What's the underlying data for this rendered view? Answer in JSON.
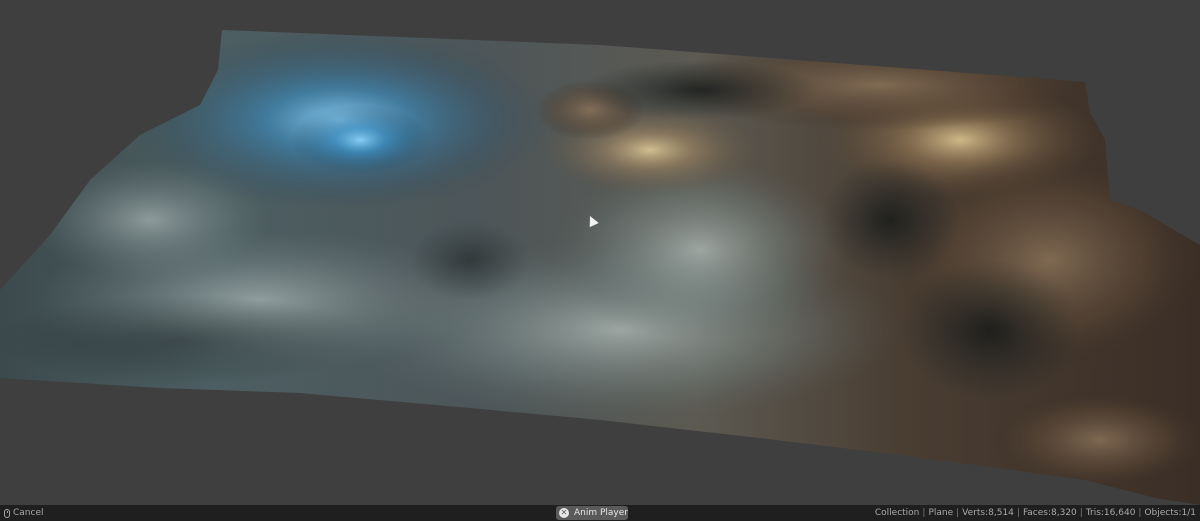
{
  "viewport": {
    "background": "#3f3f3f",
    "object": "terrain-plane-with-rock-and-foam-texture"
  },
  "statusbar": {
    "left_label": "Cancel",
    "center_button": "Anim Player",
    "stats": [
      "Collection",
      "Plane",
      "Verts:8,514",
      "Faces:8,320",
      "Tris:16,640",
      "Objects:1/1"
    ]
  }
}
